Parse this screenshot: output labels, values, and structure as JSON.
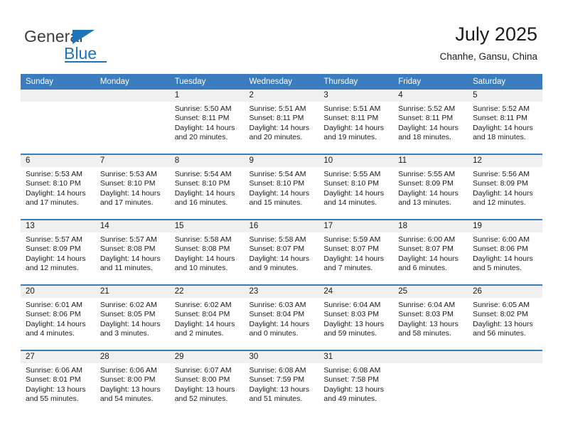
{
  "brand": {
    "logo_text_primary": "General",
    "logo_text_secondary": "Blue",
    "logo_icon": "triangle-icon",
    "accent_color": "#1f73b8"
  },
  "header": {
    "month_title": "July 2025",
    "location": "Chanhe, Gansu, China"
  },
  "calendar": {
    "header_bg_color": "#3a7cbe",
    "daynum_band_color": "#f0f0f0",
    "weekday_headers": [
      "Sunday",
      "Monday",
      "Tuesday",
      "Wednesday",
      "Thursday",
      "Friday",
      "Saturday"
    ],
    "weeks": [
      [
        {
          "day": "",
          "empty": true
        },
        {
          "day": "",
          "empty": true
        },
        {
          "day": "1",
          "sunrise": "Sunrise: 5:50 AM",
          "sunset": "Sunset: 8:11 PM",
          "daylight": "Daylight: 14 hours and 20 minutes."
        },
        {
          "day": "2",
          "sunrise": "Sunrise: 5:51 AM",
          "sunset": "Sunset: 8:11 PM",
          "daylight": "Daylight: 14 hours and 20 minutes."
        },
        {
          "day": "3",
          "sunrise": "Sunrise: 5:51 AM",
          "sunset": "Sunset: 8:11 PM",
          "daylight": "Daylight: 14 hours and 19 minutes."
        },
        {
          "day": "4",
          "sunrise": "Sunrise: 5:52 AM",
          "sunset": "Sunset: 8:11 PM",
          "daylight": "Daylight: 14 hours and 18 minutes."
        },
        {
          "day": "5",
          "sunrise": "Sunrise: 5:52 AM",
          "sunset": "Sunset: 8:11 PM",
          "daylight": "Daylight: 14 hours and 18 minutes."
        }
      ],
      [
        {
          "day": "6",
          "sunrise": "Sunrise: 5:53 AM",
          "sunset": "Sunset: 8:10 PM",
          "daylight": "Daylight: 14 hours and 17 minutes."
        },
        {
          "day": "7",
          "sunrise": "Sunrise: 5:53 AM",
          "sunset": "Sunset: 8:10 PM",
          "daylight": "Daylight: 14 hours and 17 minutes."
        },
        {
          "day": "8",
          "sunrise": "Sunrise: 5:54 AM",
          "sunset": "Sunset: 8:10 PM",
          "daylight": "Daylight: 14 hours and 16 minutes."
        },
        {
          "day": "9",
          "sunrise": "Sunrise: 5:54 AM",
          "sunset": "Sunset: 8:10 PM",
          "daylight": "Daylight: 14 hours and 15 minutes."
        },
        {
          "day": "10",
          "sunrise": "Sunrise: 5:55 AM",
          "sunset": "Sunset: 8:10 PM",
          "daylight": "Daylight: 14 hours and 14 minutes."
        },
        {
          "day": "11",
          "sunrise": "Sunrise: 5:55 AM",
          "sunset": "Sunset: 8:09 PM",
          "daylight": "Daylight: 14 hours and 13 minutes."
        },
        {
          "day": "12",
          "sunrise": "Sunrise: 5:56 AM",
          "sunset": "Sunset: 8:09 PM",
          "daylight": "Daylight: 14 hours and 12 minutes."
        }
      ],
      [
        {
          "day": "13",
          "sunrise": "Sunrise: 5:57 AM",
          "sunset": "Sunset: 8:09 PM",
          "daylight": "Daylight: 14 hours and 12 minutes."
        },
        {
          "day": "14",
          "sunrise": "Sunrise: 5:57 AM",
          "sunset": "Sunset: 8:08 PM",
          "daylight": "Daylight: 14 hours and 11 minutes."
        },
        {
          "day": "15",
          "sunrise": "Sunrise: 5:58 AM",
          "sunset": "Sunset: 8:08 PM",
          "daylight": "Daylight: 14 hours and 10 minutes."
        },
        {
          "day": "16",
          "sunrise": "Sunrise: 5:58 AM",
          "sunset": "Sunset: 8:07 PM",
          "daylight": "Daylight: 14 hours and 9 minutes."
        },
        {
          "day": "17",
          "sunrise": "Sunrise: 5:59 AM",
          "sunset": "Sunset: 8:07 PM",
          "daylight": "Daylight: 14 hours and 7 minutes."
        },
        {
          "day": "18",
          "sunrise": "Sunrise: 6:00 AM",
          "sunset": "Sunset: 8:07 PM",
          "daylight": "Daylight: 14 hours and 6 minutes."
        },
        {
          "day": "19",
          "sunrise": "Sunrise: 6:00 AM",
          "sunset": "Sunset: 8:06 PM",
          "daylight": "Daylight: 14 hours and 5 minutes."
        }
      ],
      [
        {
          "day": "20",
          "sunrise": "Sunrise: 6:01 AM",
          "sunset": "Sunset: 8:06 PM",
          "daylight": "Daylight: 14 hours and 4 minutes."
        },
        {
          "day": "21",
          "sunrise": "Sunrise: 6:02 AM",
          "sunset": "Sunset: 8:05 PM",
          "daylight": "Daylight: 14 hours and 3 minutes."
        },
        {
          "day": "22",
          "sunrise": "Sunrise: 6:02 AM",
          "sunset": "Sunset: 8:04 PM",
          "daylight": "Daylight: 14 hours and 2 minutes."
        },
        {
          "day": "23",
          "sunrise": "Sunrise: 6:03 AM",
          "sunset": "Sunset: 8:04 PM",
          "daylight": "Daylight: 14 hours and 0 minutes."
        },
        {
          "day": "24",
          "sunrise": "Sunrise: 6:04 AM",
          "sunset": "Sunset: 8:03 PM",
          "daylight": "Daylight: 13 hours and 59 minutes."
        },
        {
          "day": "25",
          "sunrise": "Sunrise: 6:04 AM",
          "sunset": "Sunset: 8:03 PM",
          "daylight": "Daylight: 13 hours and 58 minutes."
        },
        {
          "day": "26",
          "sunrise": "Sunrise: 6:05 AM",
          "sunset": "Sunset: 8:02 PM",
          "daylight": "Daylight: 13 hours and 56 minutes."
        }
      ],
      [
        {
          "day": "27",
          "sunrise": "Sunrise: 6:06 AM",
          "sunset": "Sunset: 8:01 PM",
          "daylight": "Daylight: 13 hours and 55 minutes."
        },
        {
          "day": "28",
          "sunrise": "Sunrise: 6:06 AM",
          "sunset": "Sunset: 8:00 PM",
          "daylight": "Daylight: 13 hours and 54 minutes."
        },
        {
          "day": "29",
          "sunrise": "Sunrise: 6:07 AM",
          "sunset": "Sunset: 8:00 PM",
          "daylight": "Daylight: 13 hours and 52 minutes."
        },
        {
          "day": "30",
          "sunrise": "Sunrise: 6:08 AM",
          "sunset": "Sunset: 7:59 PM",
          "daylight": "Daylight: 13 hours and 51 minutes."
        },
        {
          "day": "31",
          "sunrise": "Sunrise: 6:08 AM",
          "sunset": "Sunset: 7:58 PM",
          "daylight": "Daylight: 13 hours and 49 minutes."
        },
        {
          "day": "",
          "empty": true
        },
        {
          "day": "",
          "empty": true
        }
      ]
    ]
  }
}
